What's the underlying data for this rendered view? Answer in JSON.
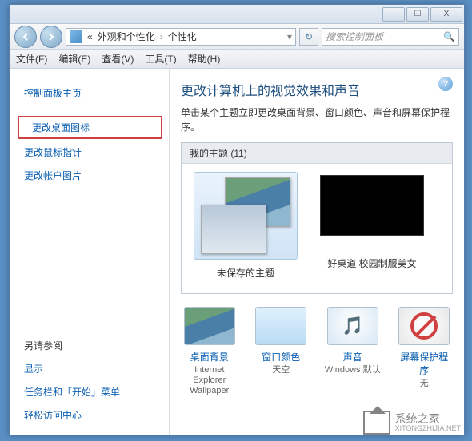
{
  "titlebar": {
    "min": "—",
    "max": "☐",
    "close": "X"
  },
  "address": {
    "prefix": "«",
    "seg1": "外观和个性化",
    "seg2": "个性化",
    "sep": "›"
  },
  "search": {
    "placeholder": "搜索控制面板"
  },
  "menu": {
    "file": "文件(F)",
    "edit": "编辑(E)",
    "view": "查看(V)",
    "tools": "工具(T)",
    "help": "帮助(H)"
  },
  "sidebar": {
    "home": "控制面板主页",
    "desktop_icons": "更改桌面图标",
    "mouse_pointers": "更改鼠标指针",
    "account_picture": "更改帐户图片",
    "see_also": "另请参阅",
    "display": "显示",
    "taskbar": "任务栏和「开始」菜单",
    "ease": "轻松访问中心"
  },
  "main": {
    "title": "更改计算机上的视觉效果和声音",
    "desc": "单击某个主题立即更改桌面背景、窗口颜色、声音和屏幕保护程序。",
    "themes_header": "我的主题 (11)",
    "theme1": "未保存的主题",
    "theme2": "好桌道 校园制服美女"
  },
  "bottom": {
    "wallpaper": {
      "label": "桌面背景",
      "sub": "Internet Explorer Wallpaper"
    },
    "color": {
      "label": "窗口颜色",
      "sub": "天空"
    },
    "sound": {
      "label": "声音",
      "sub": "Windows 默认"
    },
    "saver": {
      "label": "屏幕保护程序",
      "sub": "无"
    }
  },
  "watermark": {
    "text": "系统之家",
    "sub": "XITONGZHIJIA.NET"
  }
}
